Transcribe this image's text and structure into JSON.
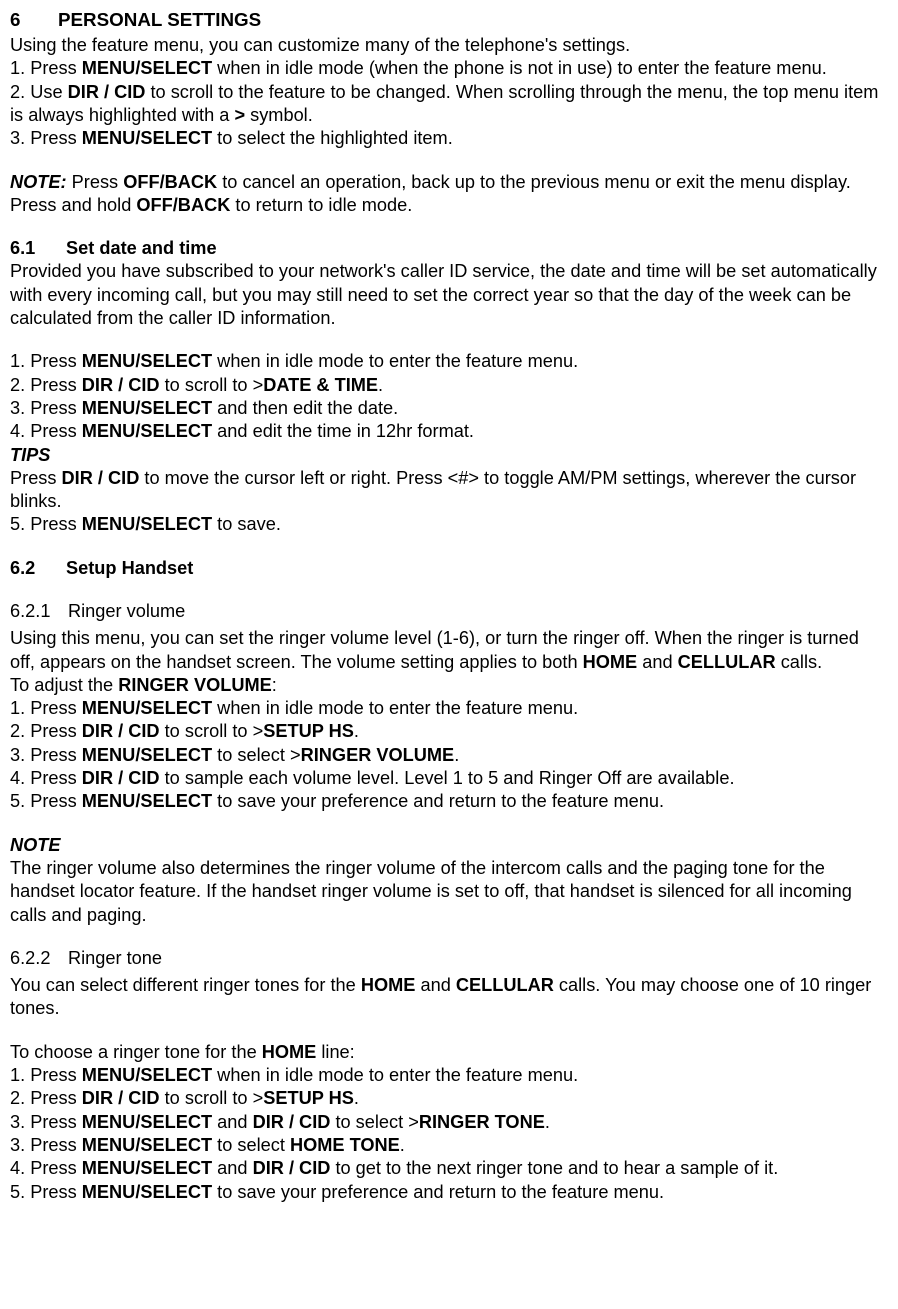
{
  "s6": {
    "num": "6",
    "title": "PERSONAL SETTINGS",
    "intro": "Using the feature menu, you can customize many of the telephone's settings.",
    "step1a": "1. Press ",
    "step1b": "MENU/SELECT",
    "step1c": " when in idle mode (when the phone is not in use) to enter the feature menu.",
    "step2a": "2. Use ",
    "step2b": "DIR / CID",
    "step2c": " to scroll to the feature to be changed. When scrolling through the menu, the top menu item is always highlighted with a ",
    "step2d": ">",
    "step2e": " symbol.",
    "step3a": "3. Press ",
    "step3b": "MENU/SELECT",
    "step3c": " to select the highlighted item.",
    "noteLabel": "NOTE:",
    "note1a": " Press ",
    "note1b": "OFF/BACK",
    "note1c": " to cancel an operation, back up to the previous menu or exit the menu display. Press and hold ",
    "note1d": "OFF/BACK",
    "note1e": " to return to idle mode."
  },
  "s61": {
    "num": "6.1",
    "title": "Set date and time",
    "intro": "Provided you have subscribed to your network's caller ID service, the date and time will be set automatically with every incoming call, but you may still need to set the correct year so that the day of the week can be calculated from the caller ID information.",
    "st1a": "1. Press ",
    "st1b": "MENU/SELECT",
    "st1c": " when in idle mode to enter the feature menu.",
    "st2a": "2. Press ",
    "st2b": "DIR / CID",
    "st2c": " to scroll to >",
    "st2d": "DATE & TIME",
    "st2e": ".",
    "st3a": "3. Press ",
    "st3b": "MENU/SELECT",
    "st3c": " and then edit the date.",
    "st4a": "4. Press ",
    "st4b": "MENU/SELECT",
    "st4c": " and edit the time in 12hr format.",
    "tipsLabel": "TIPS",
    "tips1a": "Press ",
    "tips1b": "DIR / CID",
    "tips1c": " to move the cursor left or right. Press <#> to toggle AM/PM settings, wherever the cursor blinks.",
    "st5a": "5. Press ",
    "st5b": "MENU/SELECT",
    "st5c": " to save."
  },
  "s62": {
    "num": "6.2",
    "title": "Setup Handset"
  },
  "s621": {
    "num": "6.2.1",
    "title": "Ringer volume",
    "p1a": "Using this menu, you can set the ringer volume level (1-6), or turn the ringer off. When the ringer is turned off, appears on the handset screen. The volume setting applies to both ",
    "p1b": "HOME",
    "p1c": " and ",
    "p1d": "CELLULAR",
    "p1e": " calls.",
    "p2a": "To adjust the ",
    "p2b": "RINGER VOLUME",
    "p2c": ":",
    "st1a": "1. Press ",
    "st1b": "MENU/SELECT",
    "st1c": " when in idle mode to enter the feature menu.",
    "st2a": "2. Press ",
    "st2b": "DIR / CID",
    "st2c": " to scroll to >",
    "st2d": "SETUP HS",
    "st2e": ".",
    "st3a": "3. Press ",
    "st3b": "MENU/SELECT",
    "st3c": " to select >",
    "st3d": "RINGER VOLUME",
    "st3e": ".",
    "st4a": "4. Press ",
    "st4b": "DIR / CID",
    "st4c": " to sample each volume level. Level 1 to 5 and Ringer Off are available.",
    "st5a": "5. Press ",
    "st5b": "MENU/SELECT",
    "st5c": " to save your preference and return to the feature menu.",
    "noteLabel": "NOTE",
    "noteText": "The ringer volume also determines the ringer volume of the intercom calls and the paging tone for the handset locator feature. If the handset ringer volume is set to off, that handset is silenced for all incoming calls and paging."
  },
  "s622": {
    "num": "6.2.2",
    "title": "Ringer tone",
    "p1a": "You can select different ringer tones for the ",
    "p1b": "HOME",
    "p1c": " and ",
    "p1d": "CELLULAR",
    "p1e": " calls. You may choose one of 10 ringer tones.",
    "p2a": "To choose a ringer tone for the ",
    "p2b": "HOME",
    "p2c": " line:",
    "st1a": "1. Press ",
    "st1b": "MENU/SELECT",
    "st1c": " when in idle mode to enter the feature menu.",
    "st2a": "2. Press ",
    "st2b": "DIR / CID",
    "st2c": " to scroll to >",
    "st2d": "SETUP HS",
    "st2e": ".",
    "st3a": "3. Press ",
    "st3b": "MENU/SELECT",
    "st3c": " and ",
    "st3d": "DIR / CID",
    "st3e": " to select >",
    "st3f": "RINGER TONE",
    "st3g": ".",
    "st3xa": "3. Press ",
    "st3xb": "MENU/SELECT",
    "st3xc": " to select ",
    "st3xd": "HOME TONE",
    "st3xe": ".",
    "st4a": "4. Press ",
    "st4b": "MENU/SELECT",
    "st4c": " and ",
    "st4d": "DIR / CID",
    "st4e": " to get to the next ringer tone and to hear a sample of it.",
    "st5a": "5. Press ",
    "st5b": "MENU/SELECT",
    "st5c": " to save your preference and return to the feature menu."
  }
}
